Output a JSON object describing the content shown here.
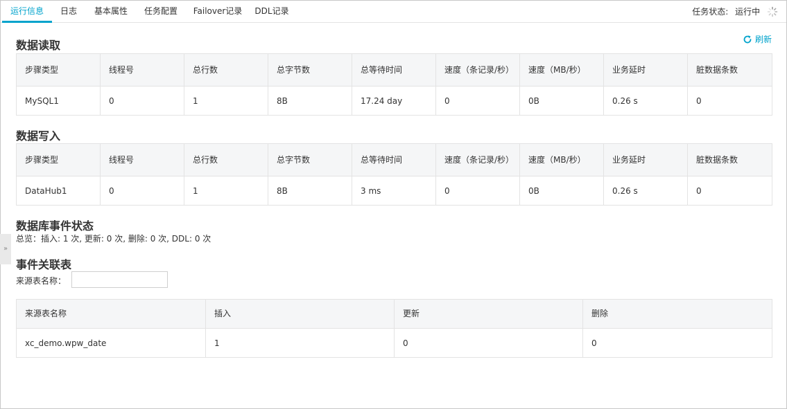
{
  "tabs": [
    {
      "label": "运行信息",
      "active": true
    },
    {
      "label": "日志"
    },
    {
      "label": "基本属性"
    },
    {
      "label": "任务配置"
    },
    {
      "label": "Failover记录"
    },
    {
      "label": "DDL记录"
    }
  ],
  "status": {
    "label": "任务状态:",
    "value": "运行中"
  },
  "refresh_label": "刷新",
  "read_section": {
    "title": "数据读取",
    "columns": [
      "步骤类型",
      "线程号",
      "总行数",
      "总字节数",
      "总等待时间",
      "速度（条记录/秒）",
      "速度（MB/秒）",
      "业务延时",
      "脏数据条数"
    ],
    "rows": [
      [
        "MySQL1",
        "0",
        "1",
        "8B",
        "17.24 day",
        "0",
        "0B",
        "0.26 s",
        "0"
      ]
    ]
  },
  "write_section": {
    "title": "数据写入",
    "columns": [
      "步骤类型",
      "线程号",
      "总行数",
      "总字节数",
      "总等待时间",
      "速度（条记录/秒）",
      "速度（MB/秒）",
      "业务延时",
      "脏数据条数"
    ],
    "rows": [
      [
        "DataHub1",
        "0",
        "1",
        "8B",
        "3 ms",
        "0",
        "0B",
        "0.26 s",
        "0"
      ]
    ]
  },
  "db_event": {
    "title": "数据库事件状态",
    "summary": "总览：插入: 1 次, 更新: 0 次, 删除: 0 次, DDL: 0 次"
  },
  "event_table": {
    "title": "事件关联表",
    "filter_label": "来源表名称：",
    "filter_value": "",
    "columns": [
      "来源表名称",
      "插入",
      "更新",
      "删除"
    ],
    "rows": [
      [
        "xc_demo.wpw_date",
        "1",
        "0",
        "0"
      ]
    ]
  },
  "colors": {
    "accent": "#00a3cc",
    "header_bg": "#f5f6f7",
    "border": "#e3e3e3"
  },
  "icons": {
    "refresh": "refresh-icon",
    "spinner": "loading-spinner-icon",
    "collapse": "expand-chevron-icon"
  }
}
